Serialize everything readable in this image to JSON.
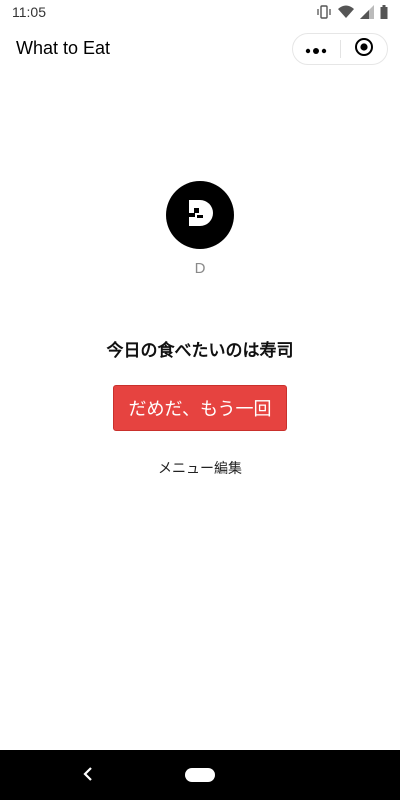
{
  "status_bar": {
    "time": "11:05",
    "icons": [
      "vibrate-icon",
      "wifi-icon",
      "signal-icon",
      "battery-icon"
    ]
  },
  "nav_bar": {
    "title": "What to Eat",
    "more_icon": "more-dots-icon",
    "close_icon": "target-circle-icon"
  },
  "main": {
    "logo_icon": "d-logo-icon",
    "logo_caption": "D",
    "result_text": "今日の食べたいのは寿司",
    "retry_button_label": "だめだ、もう一回",
    "edit_menu_label": "メニュー編集"
  },
  "colors": {
    "button_red": "#e64340",
    "logo_bg": "#000000"
  },
  "system_nav": {
    "back_icon": "back-chevron-icon",
    "home_icon": "home-pill-icon"
  }
}
